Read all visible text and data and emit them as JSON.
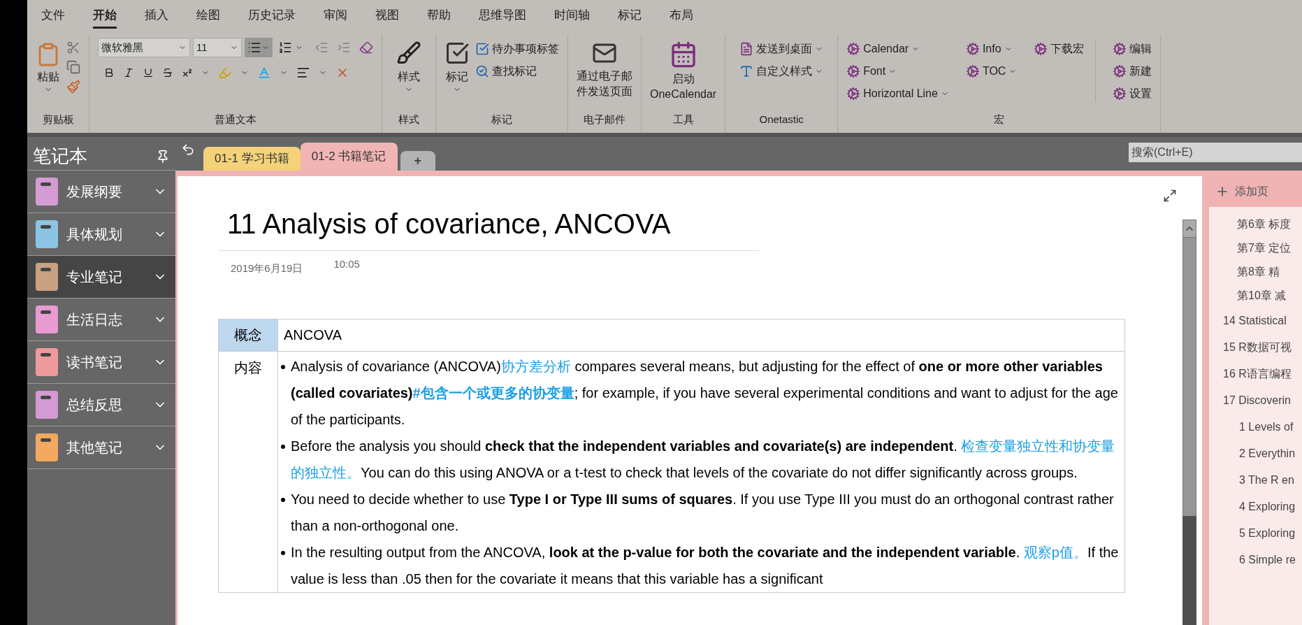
{
  "menu_tabs": [
    {
      "label": "文件",
      "selected": false
    },
    {
      "label": "开始",
      "selected": true
    },
    {
      "label": "插入",
      "selected": false
    },
    {
      "label": "绘图",
      "selected": false
    },
    {
      "label": "历史记录",
      "selected": false
    },
    {
      "label": "审阅",
      "selected": false
    },
    {
      "label": "视图",
      "selected": false
    },
    {
      "label": "帮助",
      "selected": false
    },
    {
      "label": "思维导图",
      "selected": false
    },
    {
      "label": "时间轴",
      "selected": false
    },
    {
      "label": "标记",
      "selected": false
    },
    {
      "label": "布局",
      "selected": false
    }
  ],
  "ribbon": {
    "groups": [
      {
        "kind": "clipboard",
        "title": "剪贴板",
        "paste_label": "粘贴"
      },
      {
        "kind": "text",
        "title": "普通文本",
        "font": "微软雅黑",
        "size": "11"
      },
      {
        "kind": "styles",
        "title": "样式",
        "label": "样式"
      },
      {
        "kind": "tags",
        "title": "标记",
        "label": "标记",
        "todo_label": "待办事项标签",
        "find_label": "查找标记"
      },
      {
        "kind": "email",
        "title": "电子邮件",
        "lines": [
          "通过电子邮",
          "件发送页面"
        ]
      },
      {
        "kind": "tools",
        "title": "工具",
        "lines": [
          "启动",
          "OneCalendar"
        ]
      },
      {
        "kind": "onetastic",
        "title": "Onetastic",
        "items": [
          "发送到桌面",
          "自定义样式"
        ]
      },
      {
        "kind": "macros",
        "title": "宏",
        "columns": [
          [
            {
              "label": "Calendar",
              "dropdown": true
            },
            {
              "label": "Font",
              "dropdown": true
            },
            {
              "label": "Horizontal Line",
              "dropdown": true
            }
          ],
          [
            {
              "label": "Info",
              "dropdown": true
            },
            {
              "label": "TOC",
              "dropdown": true
            }
          ],
          [
            {
              "label": "下载宏",
              "dropdown": false
            }
          ],
          [
            {
              "label": "编辑",
              "dropdown": false
            },
            {
              "label": "新建",
              "dropdown": false
            },
            {
              "label": "设置",
              "dropdown": false
            }
          ]
        ]
      }
    ]
  },
  "sidebar": {
    "title": "笔记本",
    "items": [
      {
        "label": "发展纲要",
        "color": "#d59bd3",
        "selected": false
      },
      {
        "label": "具体规划",
        "color": "#8cc5e3",
        "selected": false
      },
      {
        "label": "专业笔记",
        "color": "#c9a183",
        "selected": true
      },
      {
        "label": "生活日志",
        "color": "#e79bd0",
        "selected": false
      },
      {
        "label": "读书笔记",
        "color": "#ef9a9a",
        "selected": false
      },
      {
        "label": "总结反思",
        "color": "#d39ad3",
        "selected": false
      },
      {
        "label": "其他笔记",
        "color": "#f3a95f",
        "selected": false
      }
    ]
  },
  "section_tabs": [
    {
      "label": "01-1 学习书籍",
      "color": "#f4d27a",
      "selected": false
    },
    {
      "label": "01-2 书籍笔记",
      "color": "#f1b5b5",
      "selected": true
    }
  ],
  "add_section": "+",
  "search": {
    "placeholder": "搜索(Ctrl+E)"
  },
  "page": {
    "title": "11 Analysis of covariance, ANCOVA",
    "date": "2019年6月19日",
    "time": "10:05",
    "table": {
      "concept": {
        "label": "概念",
        "value": "ANCOVA"
      },
      "content": {
        "label": "内容",
        "bullets": [
          [
            {
              "kind": "plain",
              "text": "Analysis of covariance (ANCOVA)"
            },
            {
              "kind": "blue",
              "text": "协方差分析"
            },
            {
              "kind": "plain",
              "text": " compares several means, but adjusting for the effect of "
            },
            {
              "kind": "bold",
              "text": "one or more other variables (called covariates)"
            },
            {
              "kind": "blue_bold",
              "text": "#包含一个或更多的协变量"
            },
            {
              "kind": "plain",
              "text": "; for example, if you have several experimental conditions and want to adjust for the age of the participants."
            }
          ],
          [
            {
              "kind": "plain",
              "text": "Before the analysis you should "
            },
            {
              "kind": "bold",
              "text": "check that the independent variables and covariate(s) are independent"
            },
            {
              "kind": "plain",
              "text": ". "
            },
            {
              "kind": "blue",
              "text": "检查变量独立性和协变量的独立性。"
            },
            {
              "kind": "plain",
              "text": "You can do this using ANOVA or a t-test to check that levels of the covariate do not differ significantly across groups."
            }
          ],
          [
            {
              "kind": "plain",
              "text": "You need to decide whether to use "
            },
            {
              "kind": "bold",
              "text": "Type I or Type III sums of squares"
            },
            {
              "kind": "plain",
              "text": ". If you use Type III you must do an orthogonal contrast rather than a non-orthogonal one."
            }
          ],
          [
            {
              "kind": "plain",
              "text": "In the resulting output from the ANCOVA, "
            },
            {
              "kind": "bold",
              "text": "look at the p-value for both the covariate and the independent variable"
            },
            {
              "kind": "plain",
              "text": ". "
            },
            {
              "kind": "blue",
              "text": "观察p值。"
            },
            {
              "kind": "plain",
              "text": "If the value is less than .05 then for the covariate it means that this variable has a significant"
            }
          ]
        ]
      }
    }
  },
  "pages_pane": {
    "add_label": "添加页",
    "continued_subpages": [
      "第6章 标度",
      "第7章 定位",
      "第8章 精",
      "第10章 减"
    ],
    "pages": [
      {
        "label": "14 Statistical"
      },
      {
        "label": "15 R数据可视"
      },
      {
        "label": "16 R语言编程"
      },
      {
        "label": "17 Discoverin",
        "children": [
          {
            "label": "1 Levels of"
          },
          {
            "label": "2 Everythin"
          },
          {
            "label": "3 The R en"
          },
          {
            "label": "4 Exploring"
          },
          {
            "label": "5 Exploring"
          },
          {
            "label": "6 Simple re"
          }
        ]
      }
    ]
  }
}
